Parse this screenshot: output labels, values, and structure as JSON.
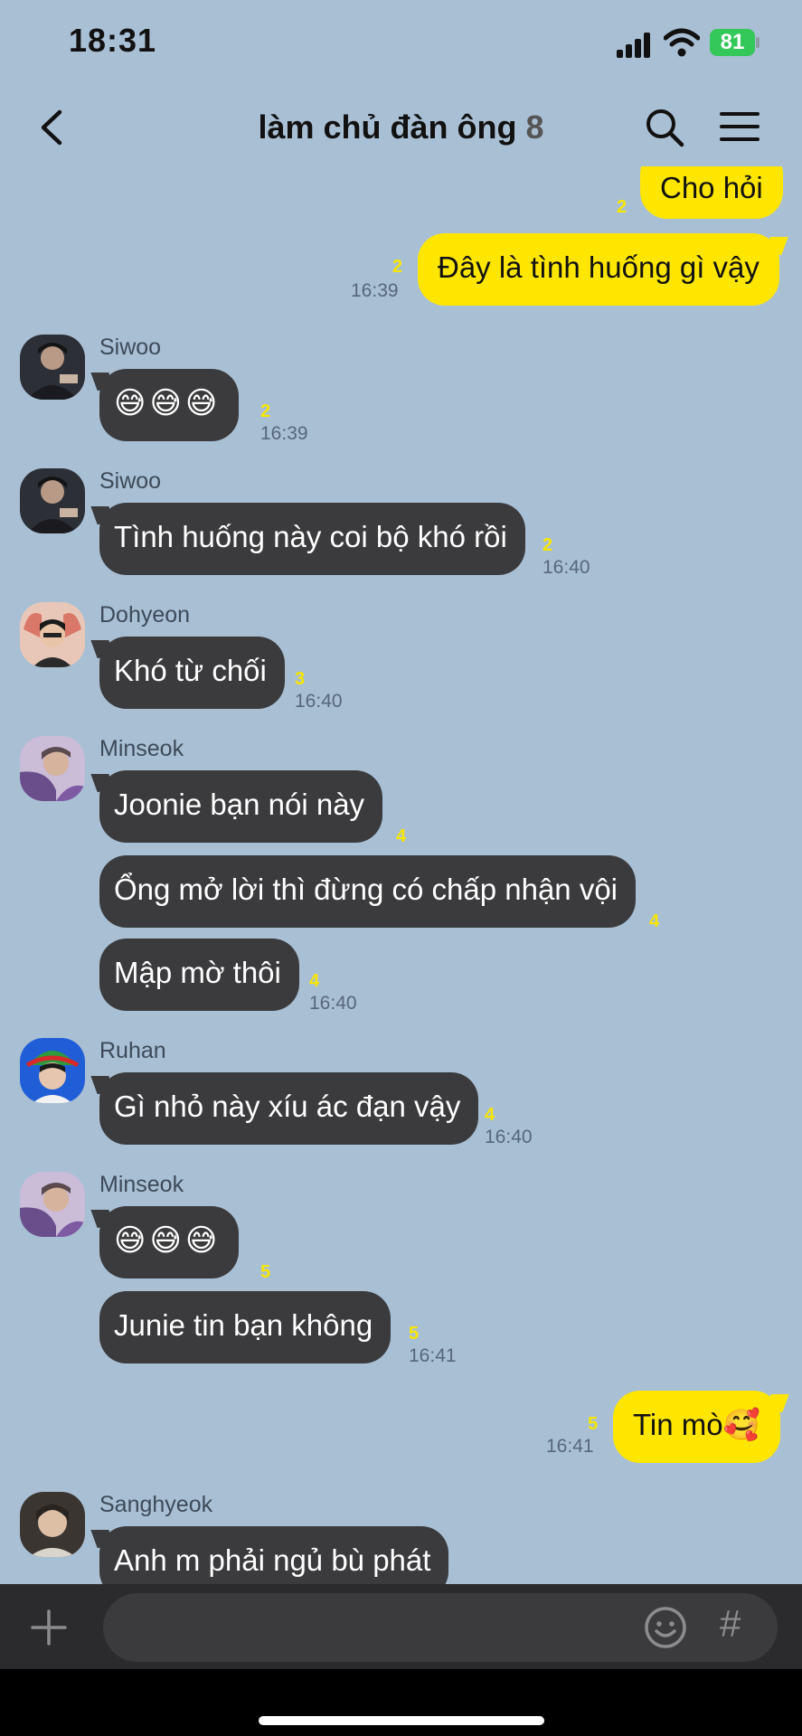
{
  "status": {
    "time": "18:31",
    "battery": "81"
  },
  "header": {
    "title": "làm chủ đàn ông",
    "member_count": "8"
  },
  "messages": {
    "m1": {
      "text": "Cho hỏi",
      "unread": "2"
    },
    "m2": {
      "text": "Đây là tình huống gì vậy",
      "unread": "2",
      "time": "16:39"
    },
    "g1": {
      "sender": "Siwoo",
      "text": "😅😅😅",
      "unread": "2",
      "time": "16:39"
    },
    "g2": {
      "sender": "Siwoo",
      "text": "Tình huống này coi bộ khó rồi",
      "unread": "2",
      "time": "16:40"
    },
    "g3": {
      "sender": "Dohyeon",
      "text": "Khó từ chối",
      "unread": "3",
      "time": "16:40"
    },
    "g4": {
      "sender": "Minseok",
      "text1": "Joonie bạn nói này",
      "unread1": "4",
      "text2": "Ổng mở lời thì đừng có chấp nhận vội",
      "unread2": "4",
      "text3": "Mập mờ thôi",
      "unread3": "4",
      "time": "16:40"
    },
    "g5": {
      "sender": "Ruhan",
      "text": "Gì nhỏ này xíu ác đạn vậy",
      "unread": "4",
      "time": "16:40"
    },
    "g6": {
      "sender": "Minseok",
      "text1": "😅😅😅",
      "unread1": "5",
      "text2": "Junie tin bạn không",
      "unread2": "5",
      "time": "16:41"
    },
    "m3": {
      "text": "Tin mò🥰",
      "unread": "5",
      "time": "16:41"
    },
    "g7": {
      "sender": "Sanghyeok",
      "text": "Anh m phải ngủ bù phát"
    }
  },
  "composer": {
    "placeholder": "",
    "hash": "#"
  },
  "colors": {
    "background": "#a9bfd4",
    "my_bubble": "#ffe600",
    "other_bubble": "#3b3b3d",
    "unread": "#f7e600"
  }
}
